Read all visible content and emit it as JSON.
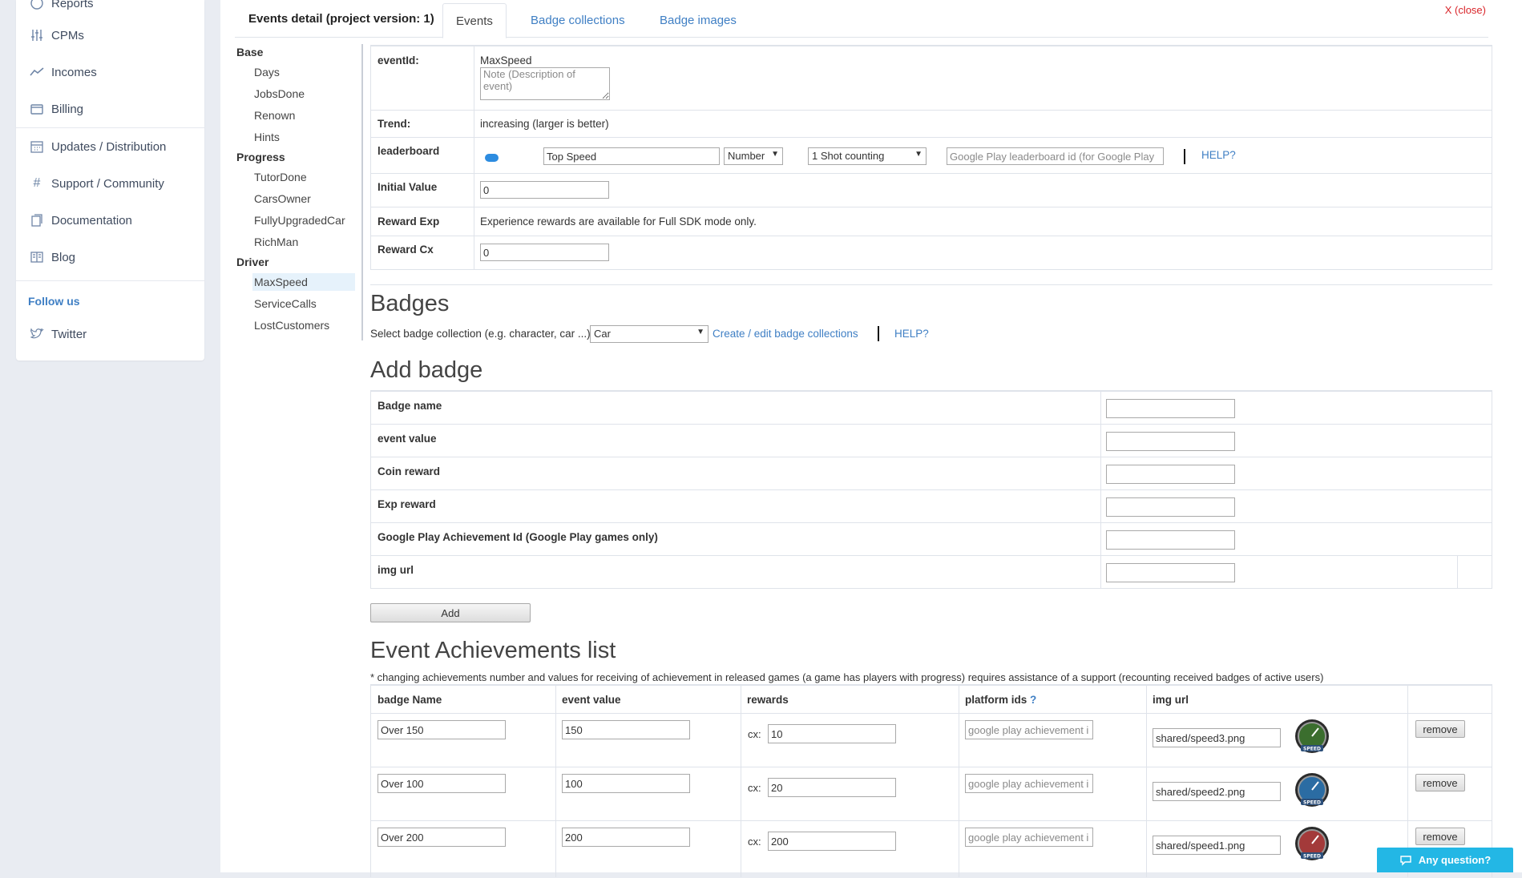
{
  "sidebar": {
    "items": [
      {
        "label": "Reports",
        "icon": "reports-icon"
      },
      {
        "label": "CPMs",
        "icon": "sliders-icon"
      },
      {
        "label": "Incomes",
        "icon": "trend-icon"
      },
      {
        "label": "Billing",
        "icon": "wallet-icon"
      },
      {
        "label": "Updates / Distribution",
        "icon": "calendar-icon"
      },
      {
        "label": "Support / Community",
        "icon": "hash-icon"
      },
      {
        "label": "Documentation",
        "icon": "docs-icon"
      },
      {
        "label": "Blog",
        "icon": "book-icon"
      }
    ],
    "follow_label": "Follow us",
    "twitter_label": "Twitter"
  },
  "header": {
    "title": "Events detail (project version: 1)",
    "tabs": [
      "Events",
      "Badge collections",
      "Badge images"
    ],
    "close": "X (close)"
  },
  "tree": {
    "groups": [
      {
        "name": "Base",
        "events": [
          "Days",
          "JobsDone",
          "Renown",
          "Hints"
        ]
      },
      {
        "name": "Progress",
        "events": [
          "TutorDone",
          "CarsOwner",
          "FullyUpgradedCar",
          "RichMan"
        ]
      },
      {
        "name": "Driver",
        "events": [
          "MaxSpeed",
          "ServiceCalls",
          "LostCustomers"
        ]
      }
    ],
    "selected": "MaxSpeed"
  },
  "detail": {
    "event_id_label": "eventId:",
    "event_id": "MaxSpeed",
    "note_placeholder": "Note (Description of event)",
    "trend_label": "Trend:",
    "trend_value": "increasing (larger is better)",
    "leaderboard_label": "leaderboard",
    "leaderboard_name": "Top Speed",
    "leaderboard_type": "Number",
    "leaderboard_mode": "1 Shot counting",
    "leaderboard_gp_placeholder": "Google Play leaderboard id (for Google Play",
    "help": "HELP?",
    "initial_label": "Initial Value",
    "initial_value": "0",
    "reward_exp_label": "Reward Exp",
    "reward_exp_text": "Experience rewards are available for Full SDK mode only.",
    "reward_cx_label": "Reward Cx",
    "reward_cx_value": "0"
  },
  "badges": {
    "heading": "Badges",
    "select_label": "Select badge collection (e.g. character, car ...)",
    "collection": "Car",
    "create_link": "Create / edit badge collections",
    "help": "HELP?"
  },
  "add_badge": {
    "heading": "Add badge",
    "fields": [
      "Badge name",
      "event value",
      "Coin reward",
      "Exp reward",
      "Google Play Achievement Id (Google Play games only)",
      "img url"
    ],
    "button": "Add"
  },
  "achievements": {
    "heading": "Event Achievements list",
    "note": "* changing achievements number and values for receiving of achievement in released games (a game has players with progress) requires assistance of a support (recounting received badges of active users)",
    "columns": [
      "badge Name",
      "event value",
      "rewards",
      "platform ids",
      "?",
      "img url"
    ],
    "cx_label": "cx:",
    "gp_placeholder": "google play achievement i",
    "remove_label": "remove",
    "rows": [
      {
        "name": "Over 150",
        "value": "150",
        "cx": "10",
        "img": "shared/speed3.png",
        "color": "#3b6e2e",
        "badge_text": "SPEED"
      },
      {
        "name": "Over 100",
        "value": "100",
        "cx": "20",
        "img": "shared/speed2.png",
        "color": "#2b6ca3",
        "badge_text": "SPEED"
      },
      {
        "name": "Over 200",
        "value": "200",
        "cx": "200",
        "img": "shared/speed1.png",
        "color": "#a33a3a",
        "badge_text": "SPEED"
      }
    ]
  },
  "chat": {
    "label": "Any question?"
  },
  "colors": {
    "link": "#3f7fc4",
    "close": "#d9262b",
    "chat": "#23b7e5",
    "selected": "#e6f2fb"
  }
}
